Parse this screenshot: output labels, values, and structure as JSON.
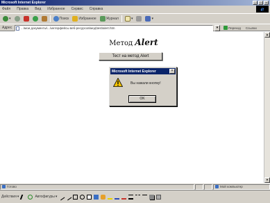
{
  "window": {
    "title": "Microsoft Internet Explorer"
  },
  "menubar": {
    "items": [
      "Файл",
      "Правка",
      "Вид",
      "Избранное",
      "Сервис",
      "Справка"
    ]
  },
  "toolbar": {
    "search_label": "Поиск",
    "favorites_label": "Избранное",
    "journal_label": "Журнал"
  },
  "address": {
    "label": "Адрес",
    "value": "...\\мои документы\\...\\интерфейсы веб-ресурсов\\мод\\test\\alert.htm",
    "go_label": "Переход",
    "links_label": "Ссылки"
  },
  "page": {
    "heading_prefix": "Метод",
    "heading_em": "Alert",
    "button_label": "Тест на метод Alert"
  },
  "dialog": {
    "title": "Microsoft Internet Explorer",
    "message": "Вы нажали кнопку!",
    "ok_label": "OK",
    "close_glyph": "×"
  },
  "status": {
    "left_text": "Готово",
    "zone_text": "Мой компьютер"
  },
  "drawbar": {
    "actions_label": "Действия",
    "autoshapes_label": "Автофигуры"
  },
  "colors": {
    "title_gradient_start": "#0a1f6e",
    "dialog_title": "#0a246a",
    "face": "#d4d0c8",
    "warning": "#f2c200"
  }
}
